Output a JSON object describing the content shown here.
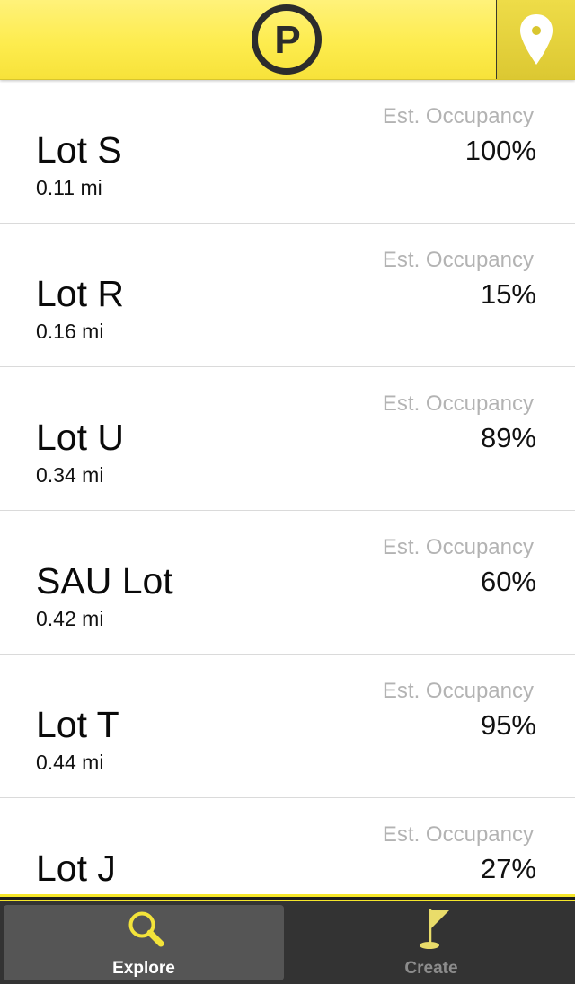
{
  "header": {
    "logo_letter": "P",
    "location_icon": "map-pin-icon"
  },
  "colors": {
    "accent_yellow": "#fdec4e",
    "tab_bar": "#333333",
    "muted_text": "#b3b3b3"
  },
  "lots": [
    {
      "name": "Lot S",
      "distance": "0.11 mi",
      "occupancy_label": "Est. Occupancy",
      "occupancy": "100%"
    },
    {
      "name": "Lot R",
      "distance": "0.16 mi",
      "occupancy_label": "Est. Occupancy",
      "occupancy": "15%"
    },
    {
      "name": "Lot U",
      "distance": "0.34 mi",
      "occupancy_label": "Est. Occupancy",
      "occupancy": "89%"
    },
    {
      "name": "SAU Lot",
      "distance": "0.42 mi",
      "occupancy_label": "Est. Occupancy",
      "occupancy": "60%"
    },
    {
      "name": "Lot T",
      "distance": "0.44 mi",
      "occupancy_label": "Est. Occupancy",
      "occupancy": "95%"
    },
    {
      "name": "Lot J",
      "distance": "",
      "occupancy_label": "Est. Occupancy",
      "occupancy": "27%"
    }
  ],
  "tabbar": {
    "explore": {
      "label": "Explore",
      "icon": "magnifier-icon",
      "selected": true
    },
    "create": {
      "label": "Create",
      "icon": "flag-icon",
      "selected": false
    }
  }
}
